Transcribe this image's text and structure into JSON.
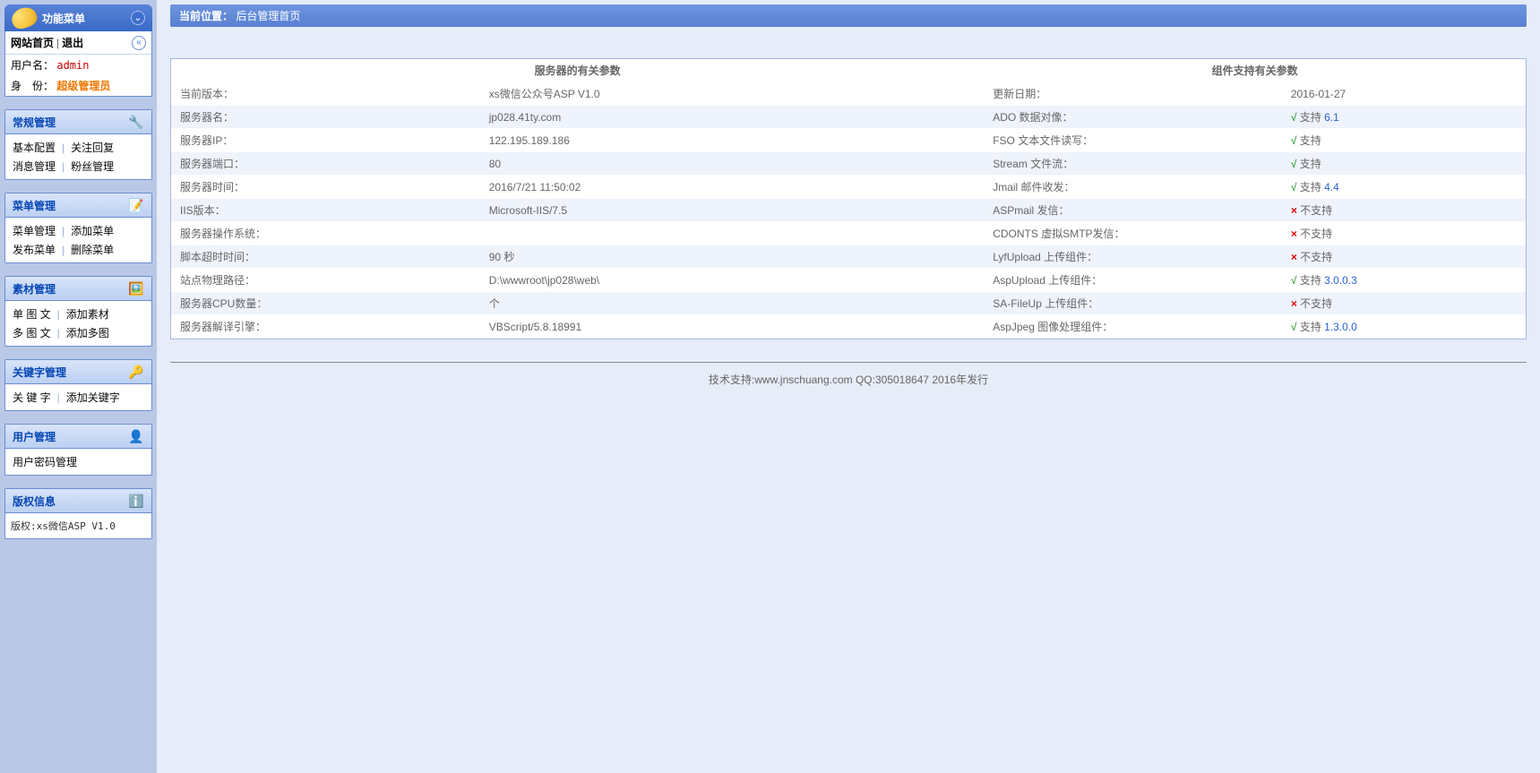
{
  "sidebar": {
    "title": "功能菜单",
    "top_links": {
      "home": "网站首页",
      "logout": "退出"
    },
    "user": {
      "name_lbl": "用户名：",
      "name": "admin",
      "role_lbl": "身　份：",
      "role": "超级管理员"
    },
    "sections": [
      {
        "title": "常规管理",
        "icon": "🔧",
        "links": [
          [
            "基本配置",
            "关注回复"
          ],
          [
            "消息管理",
            "粉丝管理"
          ]
        ]
      },
      {
        "title": "菜单管理",
        "icon": "📝",
        "links": [
          [
            "菜单管理",
            "添加菜单"
          ],
          [
            "发布菜单",
            "删除菜单"
          ]
        ]
      },
      {
        "title": "素材管理",
        "icon": "🖼️",
        "links": [
          [
            "单 图 文",
            "添加素材"
          ],
          [
            "多 图 文",
            "添加多图"
          ]
        ]
      },
      {
        "title": "关键字管理",
        "icon": "🔑",
        "links": [
          [
            "关 键 字",
            "添加关键字"
          ]
        ]
      },
      {
        "title": "用户管理",
        "icon": "👤",
        "links": [
          [
            "用户密码管理"
          ]
        ]
      },
      {
        "title": "版权信息",
        "icon": "ℹ️",
        "links": [],
        "plain": "版权:xs微信ASP V1.0"
      }
    ]
  },
  "crumb": {
    "prefix": "当前位置：",
    "pos": "后台管理首页"
  },
  "server": {
    "title": "服务器的有关参数",
    "rows": [
      [
        "当前版本：",
        "xs微信公众号ASP V1.0"
      ],
      [
        "服务器名：",
        "jp028.41ty.com"
      ],
      [
        "服务器IP：",
        "122.195.189.186"
      ],
      [
        "服务器端口：",
        "80"
      ],
      [
        "服务器时间：",
        "2016/7/21 11:50:02"
      ],
      [
        "IIS版本：",
        "Microsoft-IIS/7.5"
      ],
      [
        "服务器操作系统：",
        ""
      ],
      [
        "脚本超时时间：",
        "90 秒"
      ],
      [
        "站点物理路径：",
        "D:\\wwwroot\\jp028\\web\\"
      ],
      [
        "服务器CPU数量：",
        "个"
      ],
      [
        "服务器解译引擎：",
        "VBScript/5.8.18991"
      ]
    ]
  },
  "comp": {
    "title": "组件支持有关参数",
    "rows": [
      {
        "k": "更新日期：",
        "status": "plain",
        "text": "2016-01-27"
      },
      {
        "k": "ADO 数据对像：",
        "status": "ok",
        "ver": "6.1"
      },
      {
        "k": "FSO 文本文件读写：",
        "status": "ok"
      },
      {
        "k": "Stream 文件流：",
        "status": "ok"
      },
      {
        "k": "Jmail 邮件收发：",
        "status": "ok",
        "ver": "4.4"
      },
      {
        "k": "ASPmail 发信：",
        "status": "no"
      },
      {
        "k": "CDONTS 虚拟SMTP发信：",
        "status": "no"
      },
      {
        "k": "LyfUpload 上传组件：",
        "status": "no"
      },
      {
        "k": "AspUpload 上传组件：",
        "status": "ok",
        "ver": "3.0.0.3"
      },
      {
        "k": "SA-FileUp 上传组件：",
        "status": "no"
      },
      {
        "k": "AspJpeg 图像处理组件：",
        "status": "ok",
        "ver": "1.3.0.0"
      }
    ],
    "ok_text": "支持",
    "no_text": "不支持"
  },
  "footer": "技术支持:www.jnschuang.com QQ:305018647 2016年发行"
}
